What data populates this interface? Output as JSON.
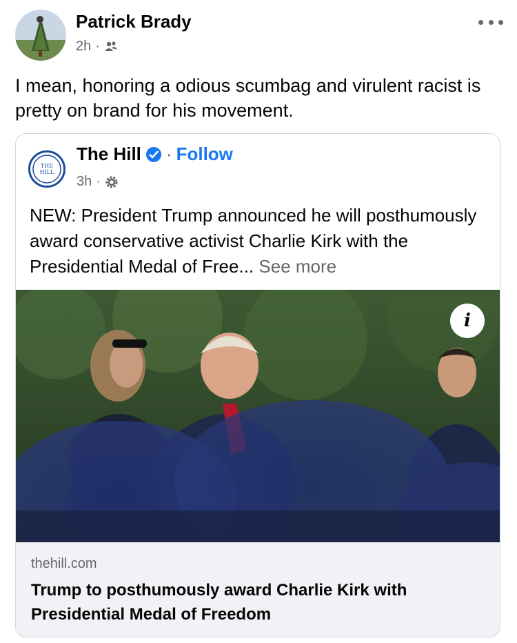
{
  "post": {
    "author": "Patrick Brady",
    "time": "2h",
    "meta_sep": "·",
    "audience_icon": "friends-icon",
    "text": "I mean, honoring a odious scumbag and virulent racist is pretty on brand for his movement."
  },
  "shared": {
    "page_name": "The Hill",
    "page_avatar_text": "THE HILL",
    "verified_icon": "verified-badge-icon",
    "follow_sep": "·",
    "follow_label": "Follow",
    "time": "3h",
    "meta_sep": "·",
    "audience_icon": "settings-gear-icon",
    "text": "NEW: President Trump announced he will posthumously award conservative activist Charlie Kirk with the Presidential Medal of Free...",
    "see_more": "See more",
    "info_glyph": "i",
    "link_domain": "thehill.com",
    "link_title": "Trump to posthumously award Charlie Kirk with Presidential Medal of Freedom"
  },
  "colors": {
    "accent": "#1877f2",
    "secondary_text": "#65676b",
    "footer_bg": "#f0f2f5"
  }
}
